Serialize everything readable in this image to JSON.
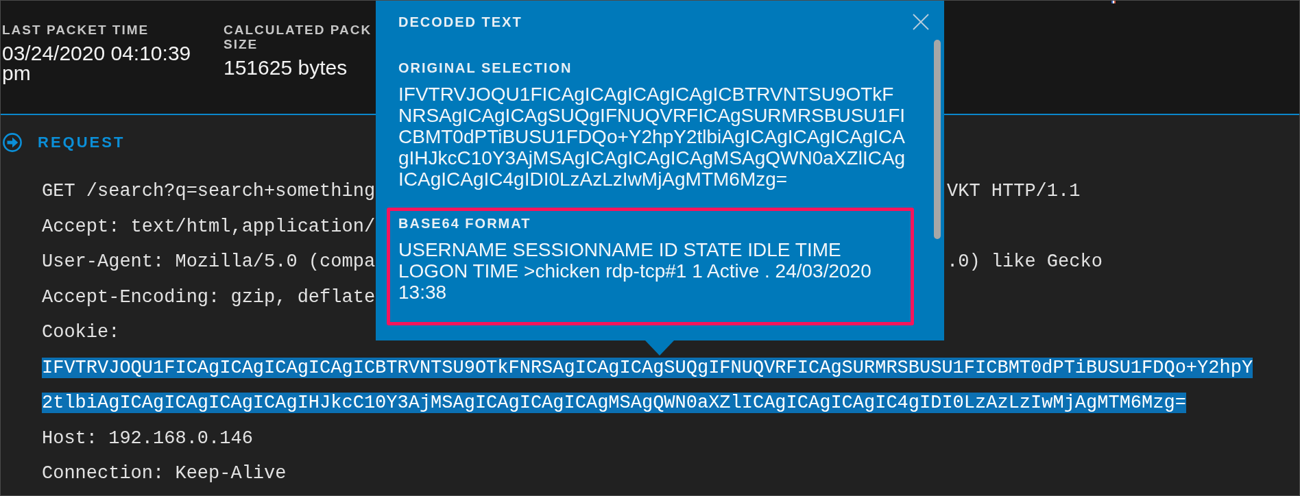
{
  "summary_fields": [
    {
      "label": "LAST PACKET TIME",
      "value": "03/24/2020 04:10:39 pm"
    },
    {
      "label": "CALCULATED PACK SIZE",
      "value": "151625 bytes"
    }
  ],
  "request": {
    "title": "REQUEST",
    "lines": [
      {
        "text": "GET /search?q=search+something",
        "tail": "VKT HTTP/1.1",
        "selected": false
      },
      {
        "text": "Accept: text/html,application/",
        "selected": false
      },
      {
        "text": "User-Agent: Mozilla/5.0 (compa",
        "tail": ".0) like Gecko",
        "selected": false
      },
      {
        "text": "Accept-Encoding: gzip, deflate",
        "selected": false
      },
      {
        "text": "Cookie:",
        "selected": false
      },
      {
        "text": "IFVTRVJOQU1FICAgICAgICAgICAgICBTRVNTSU9OTkFNRSAgICAgICAgSUQgIFNUQVRFICAgSURMRSBUSU1FICBMT0dPTiBUSU1FDQo+Y2hpY",
        "selected": true
      },
      {
        "text": "2tlbiAgICAgICAgICAgICAgIHJkcC10Y3AjMSAgICAgICAgICAgMSAgQWN0aXZlICAgICAgICAgIC4gIDI0LzAzLzIwMjAgMTM6Mzg=",
        "selected": true
      },
      {
        "text": "Host: 192.168.0.146",
        "selected": false
      },
      {
        "text": "Connection: Keep-Alive",
        "selected": false
      }
    ]
  },
  "popup": {
    "title": "DECODED TEXT",
    "sections": [
      {
        "label": "ORIGINAL SELECTION",
        "text": "IFVTRVJOQU1FICAgICAgICAgICAgICBTRVNTSU9OTkFNRSAgICAgICAgSUQgIFNUQVRFICAgSURMRSBUSU1FICBMT0dPTiBUSU1FDQo+Y2hpY2tlbiAgICAgICAgICAgICAgIHJkcC10Y3AjMSAgICAgICAgICAgMSAgQWN0aXZlICAgICAgICAgIC4gIDI0LzAzLzIwMjAgMTM6Mzg=",
        "highlighted": false
      },
      {
        "label": "BASE64 FORMAT",
        "text": "USERNAME SESSIONNAME ID STATE IDLE TIME LOGON TIME >chicken rdp-tcp#1 1 Active . 24/03/2020 13:38",
        "highlighted": true
      }
    ]
  }
}
